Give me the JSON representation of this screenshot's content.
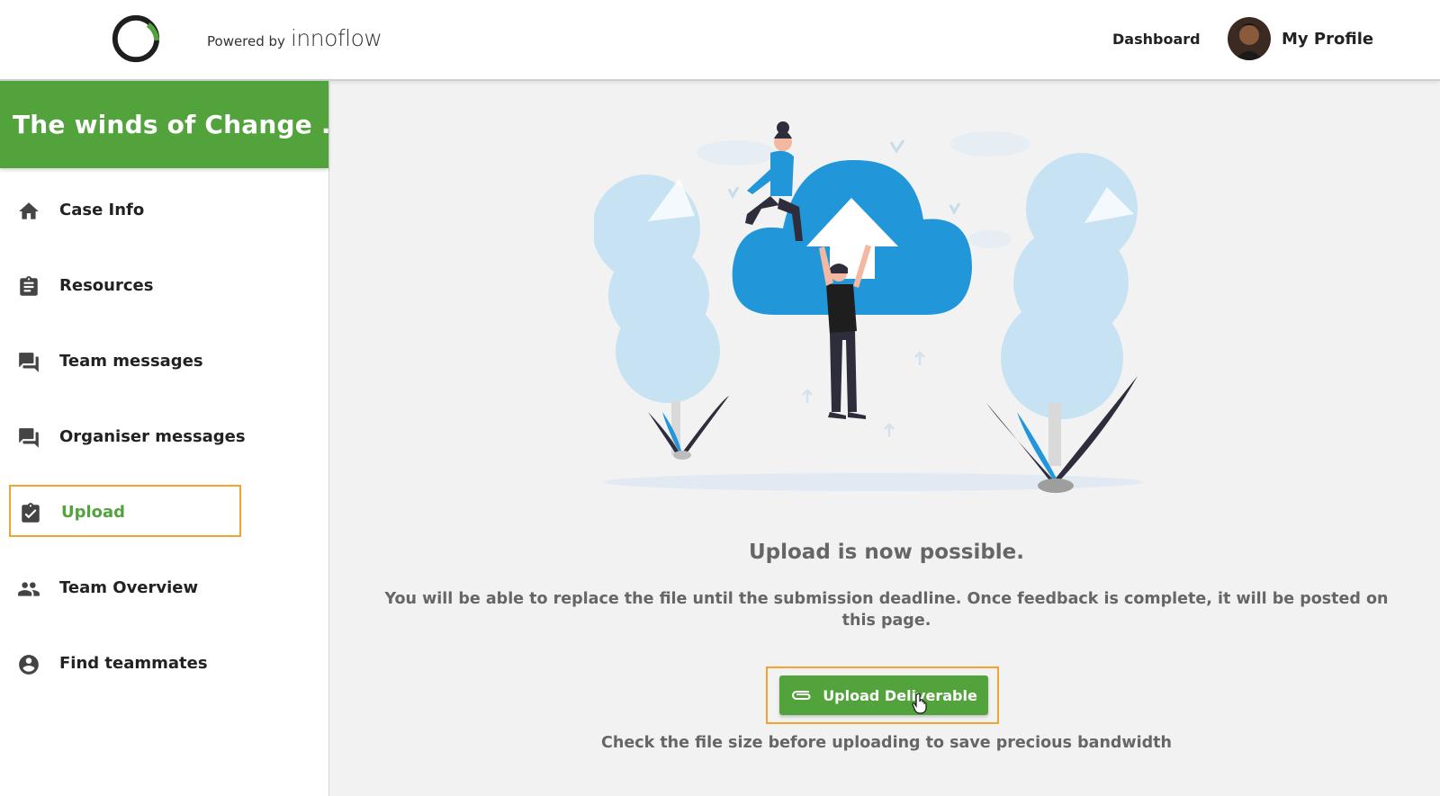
{
  "header": {
    "powered_label": "Powered by",
    "powered_brand": "innoflow",
    "nav_dashboard": "Dashboard",
    "nav_profile": "My Profile"
  },
  "sidebar": {
    "case_title": "The winds of Change ...",
    "items": [
      {
        "label": "Case Info",
        "icon": "home-icon"
      },
      {
        "label": "Resources",
        "icon": "clipboard-icon"
      },
      {
        "label": "Team messages",
        "icon": "chat-icon"
      },
      {
        "label": "Organiser messages",
        "icon": "chat-icon"
      },
      {
        "label": "Upload",
        "icon": "clipboard-check-icon",
        "active": true
      },
      {
        "label": "Team Overview",
        "icon": "people-icon"
      },
      {
        "label": "Find teammates",
        "icon": "account-circle-icon"
      }
    ]
  },
  "main": {
    "headline": "Upload is now possible.",
    "description": "You will be able to replace the file until the submission deadline. Once feedback is complete, it will be posted on this page.",
    "upload_button_label": "Upload Deliverable",
    "hint": "Check the file size before uploading to save precious bandwidth"
  },
  "colors": {
    "brand_green": "#53a33c",
    "highlight_orange": "#f3a332",
    "cloud_blue": "#2196d9",
    "tree_lightblue": "#c6e2f3"
  }
}
